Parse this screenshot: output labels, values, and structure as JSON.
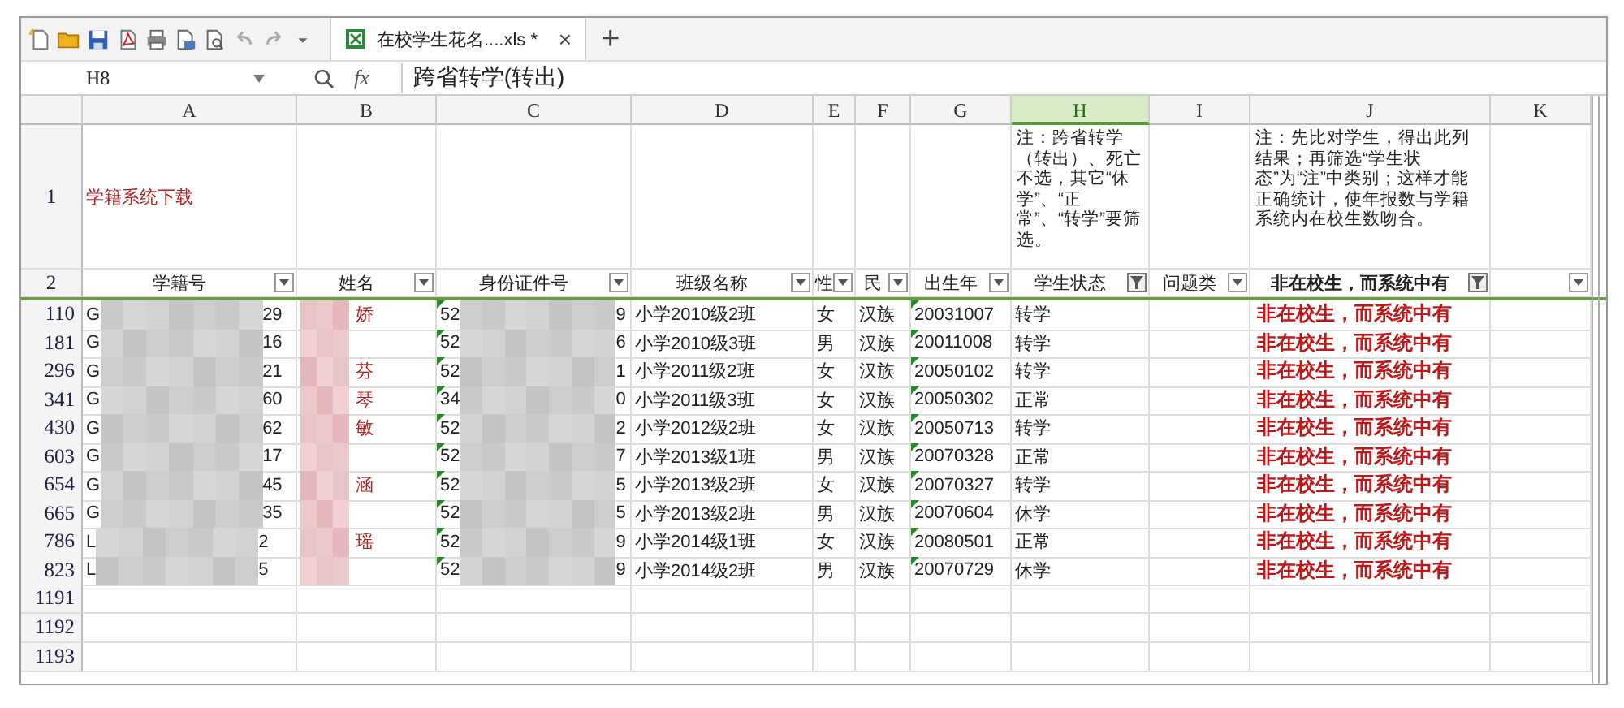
{
  "tab": {
    "title": "在校学生花名....xls *",
    "close": "×",
    "new": "+"
  },
  "formula_bar": {
    "cell": "H8",
    "fx": "fx",
    "value": "跨省转学(转出)"
  },
  "columns": [
    {
      "letter": "A",
      "selected": false,
      "header": "学籍号",
      "filtered": false
    },
    {
      "letter": "B",
      "selected": false,
      "header": "姓名",
      "filtered": false
    },
    {
      "letter": "C",
      "selected": false,
      "header": "身份证件号",
      "filtered": false
    },
    {
      "letter": "D",
      "selected": false,
      "header": "班级名称",
      "filtered": false
    },
    {
      "letter": "E",
      "selected": false,
      "header": "性",
      "filtered": false
    },
    {
      "letter": "F",
      "selected": false,
      "header": "民",
      "filtered": false
    },
    {
      "letter": "G",
      "selected": false,
      "header": "出生年",
      "filtered": false
    },
    {
      "letter": "H",
      "selected": true,
      "header": "学生状态",
      "filtered": true
    },
    {
      "letter": "I",
      "selected": false,
      "header": "问题类",
      "filtered": false
    },
    {
      "letter": "J",
      "selected": false,
      "header": "非在校生，而系统中有",
      "filtered": true
    },
    {
      "letter": "K",
      "selected": false,
      "filtered": false
    }
  ],
  "row1": {
    "number": "1",
    "title": "学籍系统下载",
    "note_h": "注：跨省转学（转出）、死亡不选，其它“休学”、“正常”、“转学”要筛选。",
    "note_j": "注：先比对学生，得出此列结果；再筛选“学生状态”为“注”中类别；这样才能正确统计，使年报数与学籍系统内在校生数吻合。"
  },
  "row2_number": "2",
  "rows": [
    {
      "number": "110",
      "id_start": "G",
      "id_end": "29",
      "name_end": "娇",
      "card_start": "52",
      "card_end": "9",
      "class": "小学2010级2班",
      "sex": "女",
      "ethnicity": "汉族",
      "birth": "20031007",
      "status": "转学",
      "result": "非在校生，而系统中有"
    },
    {
      "number": "181",
      "id_start": "G",
      "id_end": "16",
      "card_start": "52",
      "card_end": "6",
      "class": "小学2010级3班",
      "sex": "男",
      "ethnicity": "汉族",
      "birth": "20011008",
      "status": "转学",
      "result": "非在校生，而系统中有"
    },
    {
      "number": "296",
      "id_start": "G",
      "id_end": "21",
      "name_end": "芬",
      "card_start": "52",
      "card_end": "1",
      "class": "小学2011级2班",
      "sex": "女",
      "ethnicity": "汉族",
      "birth": "20050102",
      "status": "转学",
      "result": "非在校生，而系统中有"
    },
    {
      "number": "341",
      "id_start": "G",
      "id_end": "60",
      "name_end": "琴",
      "card_start": "34",
      "card_end": "0",
      "class": "小学2011级3班",
      "sex": "女",
      "ethnicity": "汉族",
      "birth": "20050302",
      "status": "正常",
      "result": "非在校生，而系统中有"
    },
    {
      "number": "430",
      "id_start": "G",
      "id_end": "62",
      "name_end": "敏",
      "card_start": "52",
      "card_end": "2",
      "class": "小学2012级2班",
      "sex": "女",
      "ethnicity": "汉族",
      "birth": "20050713",
      "status": "转学",
      "result": "非在校生，而系统中有"
    },
    {
      "number": "603",
      "id_start": "G",
      "id_end": "17",
      "card_start": "52",
      "card_end": "7",
      "class": "小学2013级1班",
      "sex": "男",
      "ethnicity": "汉族",
      "birth": "20070328",
      "status": "正常",
      "result": "非在校生，而系统中有"
    },
    {
      "number": "654",
      "id_start": "G",
      "id_end": "45",
      "name_end": "涵",
      "card_start": "52",
      "card_end": "5",
      "class": "小学2013级2班",
      "sex": "女",
      "ethnicity": "汉族",
      "birth": "20070327",
      "status": "转学",
      "result": "非在校生，而系统中有"
    },
    {
      "number": "665",
      "id_start": "G",
      "id_end": "35",
      "card_start": "52",
      "card_end": "5",
      "class": "小学2013级2班",
      "sex": "男",
      "ethnicity": "汉族",
      "birth": "20070604",
      "status": "休学",
      "result": "非在校生，而系统中有"
    },
    {
      "number": "786",
      "id_start": "L",
      "id_end": "2",
      "name_end": "瑶",
      "card_start": "52",
      "card_end": "9",
      "class": "小学2014级1班",
      "sex": "女",
      "ethnicity": "汉族",
      "birth": "20080501",
      "status": "正常",
      "result": "非在校生，而系统中有"
    },
    {
      "number": "823",
      "id_start": "L",
      "id_end": "5",
      "card_start": "52",
      "card_end": "9",
      "class": "小学2014级2班",
      "sex": "男",
      "ethnicity": "汉族",
      "birth": "20070729",
      "status": "休学",
      "result": "非在校生，而系统中有"
    }
  ],
  "empty_rows": [
    "1191",
    "1192",
    "1193"
  ]
}
